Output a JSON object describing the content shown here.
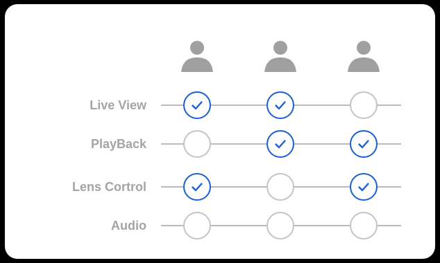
{
  "permissions": {
    "users": [
      {
        "icon": "person-icon"
      },
      {
        "icon": "person-icon"
      },
      {
        "icon": "person-icon"
      }
    ],
    "rows": [
      {
        "label": "Live View",
        "checks": [
          true,
          true,
          false
        ]
      },
      {
        "label": "PlayBack",
        "checks": [
          false,
          true,
          true
        ]
      },
      {
        "label": "Lens Cortrol",
        "checks": [
          true,
          false,
          true
        ]
      },
      {
        "label": "Audio",
        "checks": [
          false,
          false,
          false
        ]
      }
    ]
  },
  "colors": {
    "background": "#000000",
    "card": "#ffffff",
    "checked": "#1a5fd0",
    "unchecked": "#c4c4c4",
    "label": "#a4a4a4",
    "user_icon": "#a0a0a0"
  }
}
